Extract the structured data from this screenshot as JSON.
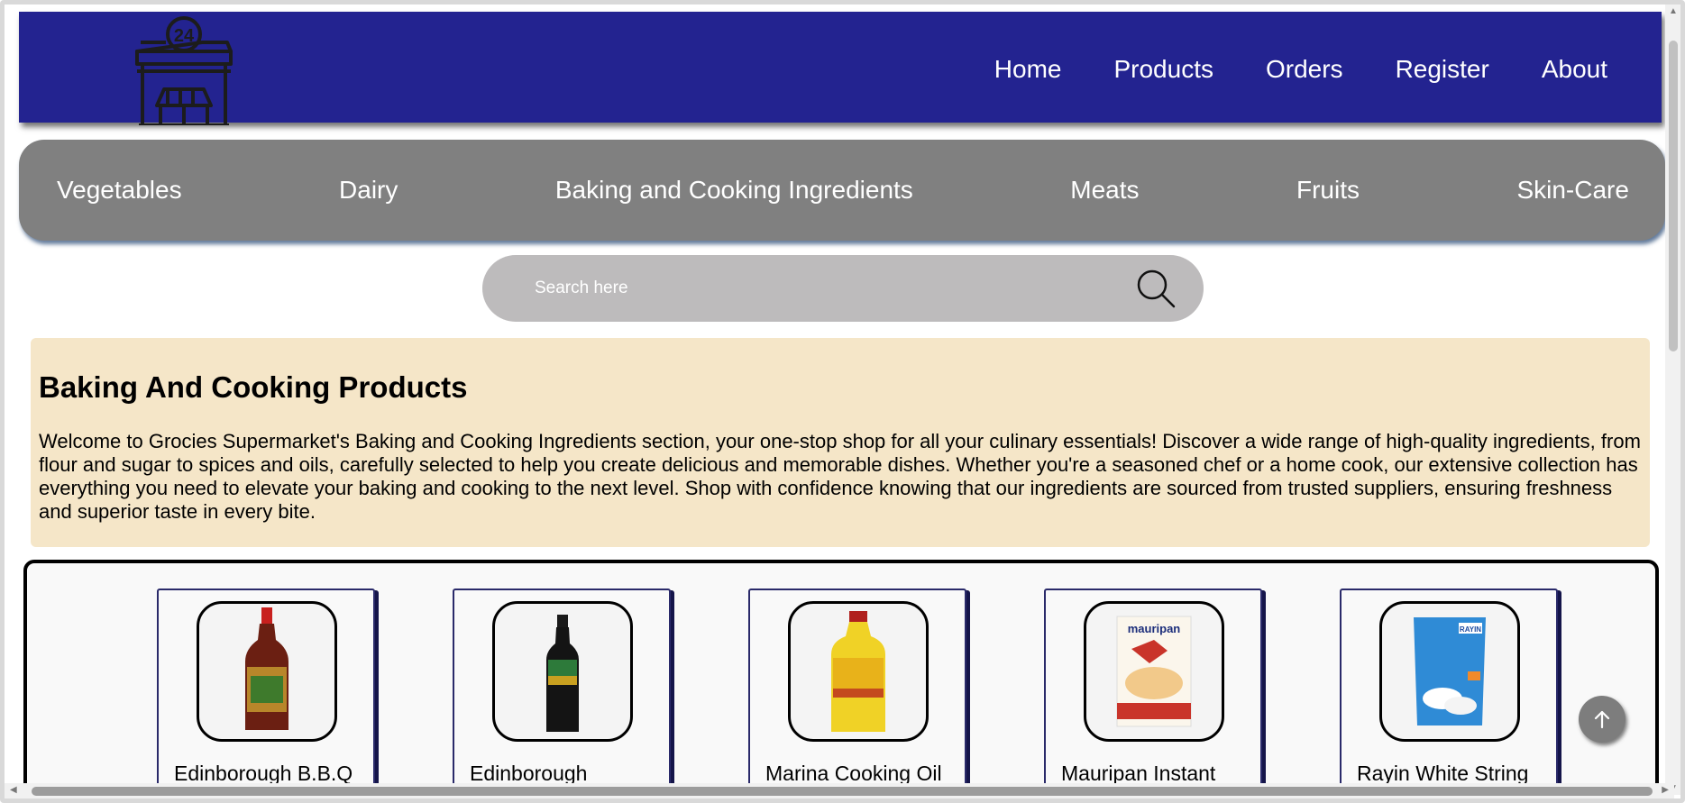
{
  "header": {
    "logo_label": "24",
    "nav": [
      "Home",
      "Products",
      "Orders",
      "Register",
      "About"
    ]
  },
  "categories": [
    "Vegetables",
    "Dairy",
    "Baking and Cooking Ingredients",
    "Meats",
    "Fruits",
    "Skin-Care"
  ],
  "search": {
    "placeholder": "Search here"
  },
  "info": {
    "title": "Baking And Cooking Products",
    "description": "Welcome to Grocies Supermarket's Baking and Cooking Ingredients section, your one-stop shop for all your culinary essentials! Discover a wide range of high-quality ingredients, from flour and sugar to spices and oils, carefully selected to help you create delicious and memorable dishes. Whether you're a seasoned chef or a home cook, our extensive collection has everything you need to elevate your baking and cooking to the next level. Shop with confidence knowing that our ingredients are sourced from trusted suppliers, ensuring freshness and superior taste in every bite."
  },
  "products": [
    {
      "name": "Edinborough B.B.Q",
      "image": "bbq-sauce-bottle"
    },
    {
      "name": "Edinborough",
      "image": "soy-sauce-bottle"
    },
    {
      "name": "Marina Cooking Oil",
      "image": "cooking-oil-bottle"
    },
    {
      "name": "Mauripan Instant",
      "image": "yeast-packet",
      "image_text": "mauripan"
    },
    {
      "name": "Rayin White String",
      "image": "string-hoppers-pack",
      "image_text": "RAYIN"
    }
  ],
  "colors": {
    "header_bg": "#232390",
    "category_bg": "#808080",
    "search_bg": "#bdbbbc",
    "info_bg": "#f5e6c8"
  }
}
